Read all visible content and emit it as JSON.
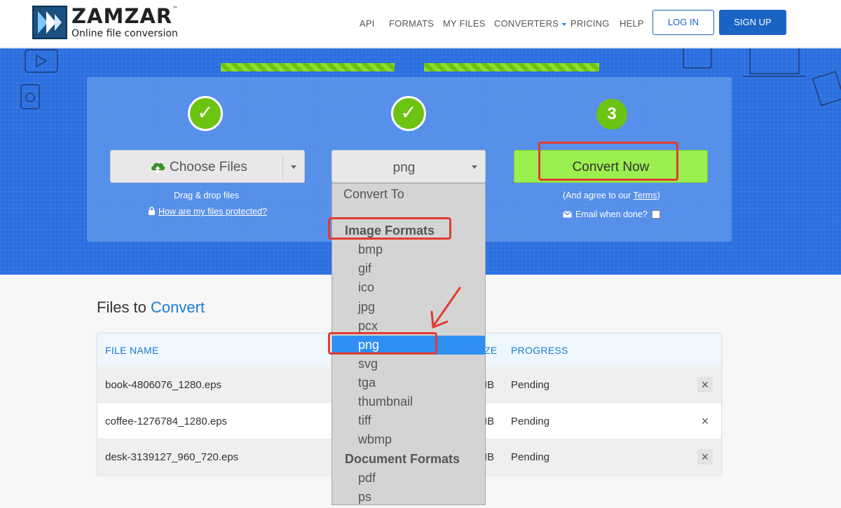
{
  "header": {
    "brand": "ZAMZAR",
    "tm": "™",
    "tagline": "Online file conversion",
    "nav": [
      "API",
      "FORMATS",
      "MY FILES",
      "CONVERTERS",
      "PRICING",
      "HELP"
    ],
    "login": "LOG IN",
    "signup": "SIGN UP"
  },
  "steps": {
    "step1_mark": "✓",
    "step2_mark": "✓",
    "step3_number": "3",
    "choose_files": "Choose Files",
    "drag_drop": "Drag & drop files",
    "protected_link": "How are my files protected?",
    "format_selected": "png",
    "convert_now": "Convert Now",
    "agree_prefix": "(And agree to our ",
    "agree_terms": "Terms",
    "agree_suffix": ")",
    "email_when_done": "Email when done?"
  },
  "dropdown": {
    "header": "Convert To",
    "image_group": "Image Formats",
    "image_options": [
      "bmp",
      "gif",
      "ico",
      "jpg",
      "pcx",
      "png",
      "svg",
      "tga",
      "thumbnail",
      "tiff",
      "wbmp"
    ],
    "selected": "png",
    "document_group": "Document Formats",
    "document_options": [
      "pdf",
      "ps"
    ]
  },
  "files": {
    "title_part1": "Files to ",
    "title_part2": "Convert",
    "columns": {
      "name": "FILE NAME",
      "size_partial": "ZE",
      "progress": "PROGRESS"
    },
    "rows": [
      {
        "name": "book-4806076_1280.eps",
        "size_partial": "IB",
        "progress": "Pending"
      },
      {
        "name": "coffee-1276784_1280.eps",
        "size_partial": "IB",
        "progress": "Pending"
      },
      {
        "name": "desk-3139127_960_720.eps",
        "size_partial": "IB",
        "progress": "Pending"
      }
    ],
    "remove_glyph": "×"
  },
  "colors": {
    "brand_blue": "#1a64c4",
    "hero_blue": "#2b6fe0",
    "step_green": "#6cc312",
    "convert_green": "#9bef4e",
    "highlight_red": "#e23b2f",
    "selected_blue": "#2f8ff2"
  }
}
